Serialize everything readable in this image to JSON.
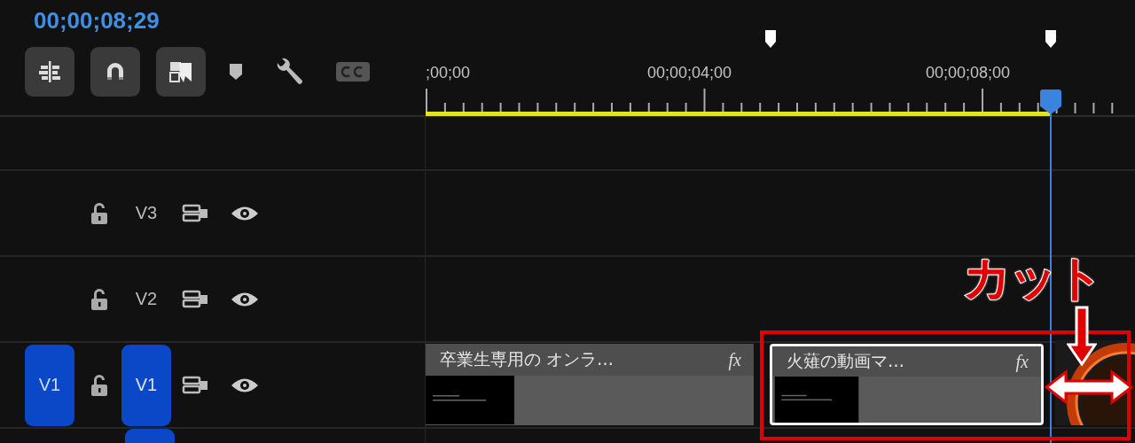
{
  "timecode": "00;00;08;29",
  "toolbar": [
    {
      "kind": "nest"
    },
    {
      "kind": "snap"
    },
    {
      "kind": "linked"
    },
    {
      "kind": "marker"
    },
    {
      "kind": "wrench"
    },
    {
      "kind": "captions"
    }
  ],
  "ruler": {
    "labels": [
      ";00;00",
      "00;00;04;00",
      "00;00;08;00"
    ]
  },
  "tracks": [
    {
      "label": "V3",
      "targeted": false
    },
    {
      "label": "V2",
      "targeted": false
    },
    {
      "label": "V1",
      "targeted": true,
      "source": "V1"
    }
  ],
  "clips": [
    {
      "title": "卒業生専用の オンラ…",
      "badge": "fx",
      "selected": false
    },
    {
      "title": "火薙の動画マ…",
      "badge": "fx",
      "selected": true
    }
  ],
  "annotation": {
    "label": "カット"
  }
}
